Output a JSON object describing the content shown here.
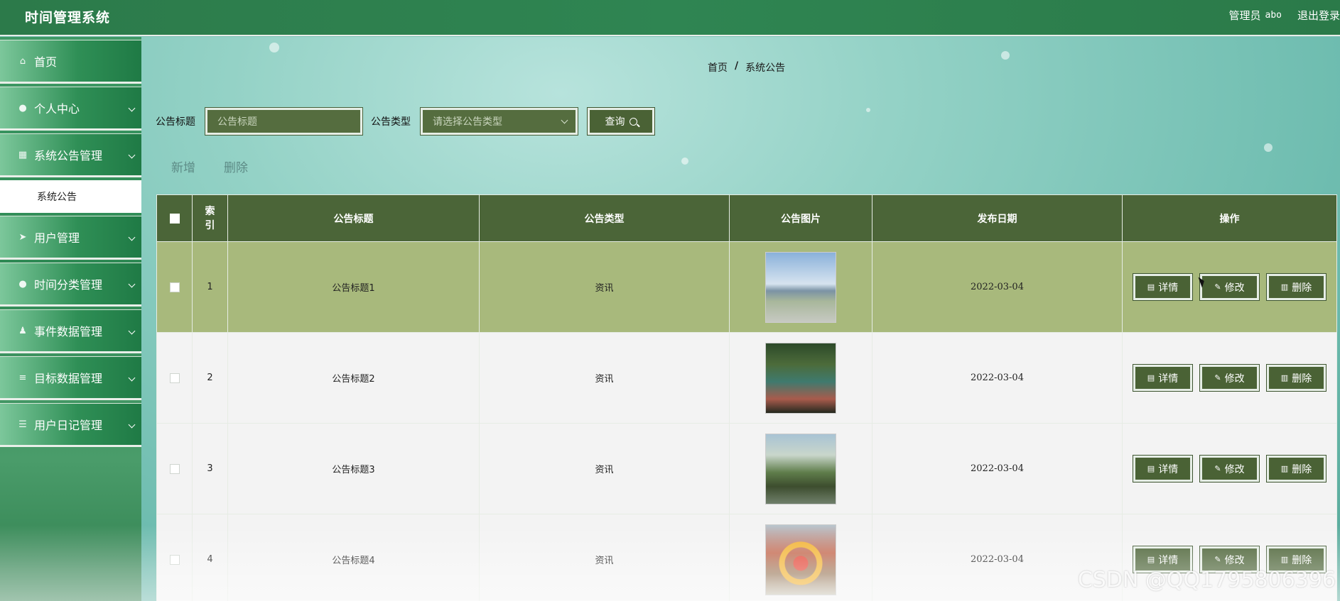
{
  "app": {
    "title": "时间管理系统"
  },
  "header": {
    "role": "管理员",
    "username": "abo",
    "logout": "退出登录"
  },
  "sidebar": {
    "items": [
      {
        "label": "首页",
        "icon": "home-icon",
        "glyph": "⌂"
      },
      {
        "label": "个人中心",
        "icon": "user-icon",
        "glyph": "●"
      },
      {
        "label": "系统公告管理",
        "icon": "grid-icon",
        "glyph": "▦"
      },
      {
        "label": "用户管理",
        "icon": "send-icon",
        "glyph": "➤"
      },
      {
        "label": "时间分类管理",
        "icon": "pin-icon",
        "glyph": "●"
      },
      {
        "label": "事件数据管理",
        "icon": "person-icon",
        "glyph": "♟"
      },
      {
        "label": "目标数据管理",
        "icon": "list-icon",
        "glyph": "≡"
      },
      {
        "label": "用户日记管理",
        "icon": "sliders-icon",
        "glyph": "☰"
      }
    ],
    "submenu": {
      "label": "系统公告"
    }
  },
  "breadcrumb": {
    "home": "首页",
    "sep": "/",
    "current": "系统公告"
  },
  "search": {
    "title_label": "公告标题",
    "title_placeholder": "公告标题",
    "type_label": "公告类型",
    "type_placeholder": "请选择公告类型",
    "query_button": "查询"
  },
  "actions": {
    "add": "新增",
    "delete": "删除"
  },
  "table": {
    "headers": [
      "索引",
      "公告标题",
      "公告类型",
      "公告图片",
      "发布日期",
      "操作"
    ],
    "rows": [
      {
        "index": "1",
        "title": "公告标题1",
        "type": "资讯",
        "date": "2022-03-04"
      },
      {
        "index": "2",
        "title": "公告标题2",
        "type": "资讯",
        "date": "2022-03-04"
      },
      {
        "index": "3",
        "title": "公告标题3",
        "type": "资讯",
        "date": "2022-03-04"
      },
      {
        "index": "4",
        "title": "公告标题4",
        "type": "资讯",
        "date": "2022-03-04"
      }
    ],
    "row_buttons": {
      "detail": "详情",
      "edit": "修改",
      "delete": "删除"
    }
  },
  "watermark": "CSDN @QQ1795806396"
}
